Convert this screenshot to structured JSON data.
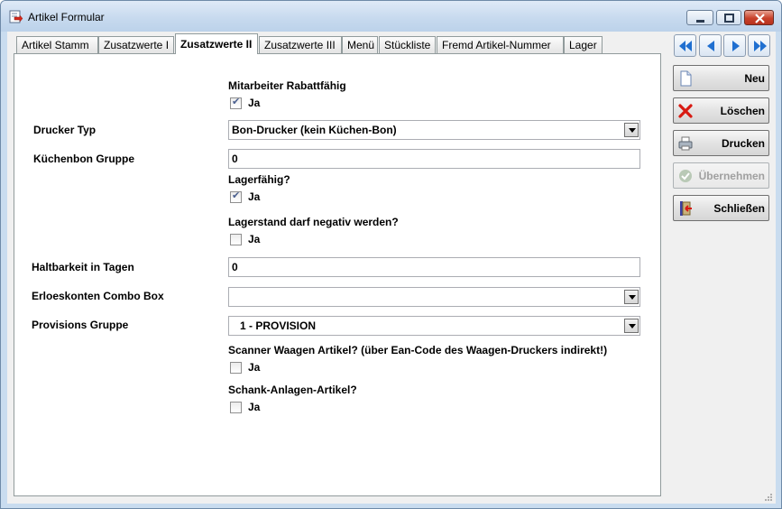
{
  "window": {
    "title": "Artikel Formular",
    "icon": "form-arrow-icon"
  },
  "tabs": [
    {
      "label": "Artikel Stamm",
      "active": false
    },
    {
      "label": "Zusatzwerte I",
      "active": false
    },
    {
      "label": "Zusatzwerte II",
      "active": true
    },
    {
      "label": "Zusatzwerte III",
      "active": false
    },
    {
      "label": "Menü",
      "active": false
    },
    {
      "label": "Stückliste",
      "active": false
    },
    {
      "label": "Fremd Artikel-Nummer",
      "active": false
    },
    {
      "label": "Lager",
      "active": false
    }
  ],
  "form": {
    "rabatt": {
      "label": "Mitarbeiter Rabattfähig",
      "checkbox_label": "Ja",
      "checked": true
    },
    "drucker_typ": {
      "label": "Drucker Typ",
      "value": "Bon-Drucker (kein Küchen-Bon)"
    },
    "kuechenbon_gruppe": {
      "label": "Küchenbon Gruppe",
      "value": "0"
    },
    "lagerfaehig": {
      "label": "Lagerfähig?",
      "checkbox_label": "Ja",
      "checked": true
    },
    "lagerstand_negativ": {
      "label": "Lagerstand darf negativ werden?",
      "checkbox_label": "Ja",
      "checked": false
    },
    "haltbarkeit": {
      "label": "Haltbarkeit in Tagen",
      "value": "0"
    },
    "erloeskonten": {
      "label": "Erloeskonten Combo Box",
      "value": ""
    },
    "provisions_gruppe": {
      "label": "Provisions Gruppe",
      "value": "1 - PROVISION"
    },
    "scanner_waagen": {
      "label": "Scanner Waagen Artikel? (über Ean-Code des Waagen-Druckers indirekt!)",
      "checkbox_label": "Ja",
      "checked": false
    },
    "schank_anlagen": {
      "label": "Schank-Anlagen-Artikel?",
      "checkbox_label": "Ja",
      "checked": false
    }
  },
  "actions": {
    "new": "Neu",
    "delete": "Löschen",
    "print": "Drucken",
    "apply": "Übernehmen",
    "close": "Schließen"
  },
  "colors": {
    "accent": "#1f6fd0",
    "delete": "#d81a12",
    "disabled_text": "#a0a0a0"
  }
}
